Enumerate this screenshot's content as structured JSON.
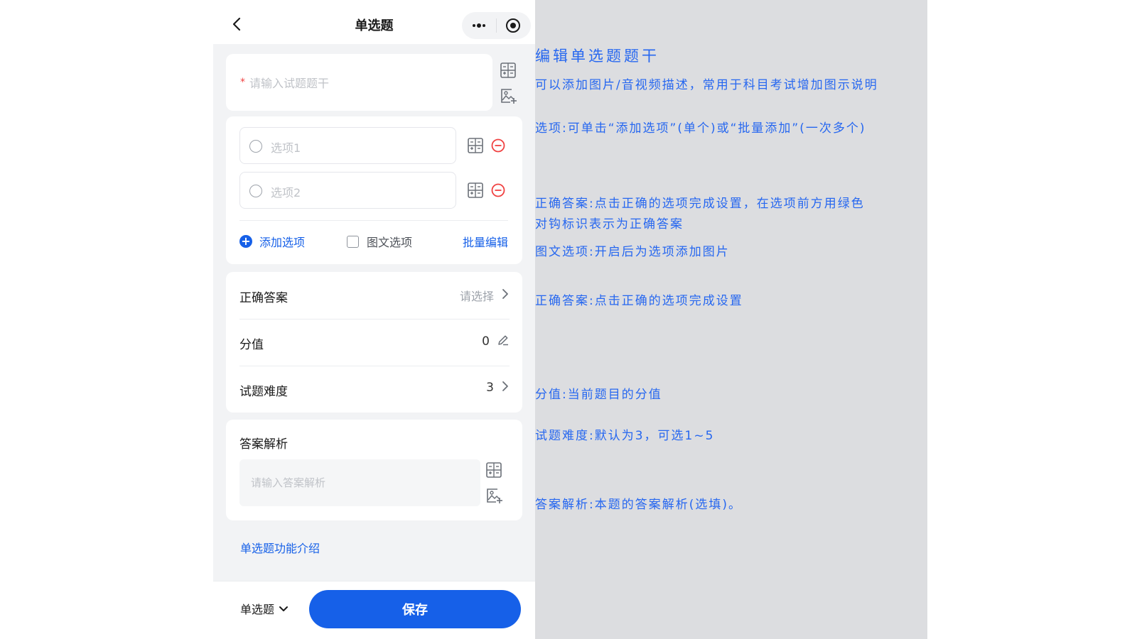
{
  "header": {
    "title": "单选题"
  },
  "stem": {
    "required_mark": "*",
    "placeholder": "请输入试题题干"
  },
  "options": {
    "items": [
      {
        "label": "选项1"
      },
      {
        "label": "选项2"
      }
    ],
    "add_label": "添加选项",
    "image_option_label": "图文选项",
    "batch_edit_label": "批量编辑"
  },
  "settings": {
    "correct_answer": {
      "label": "正确答案",
      "hint": "请选择"
    },
    "score": {
      "label": "分值",
      "value": "0"
    },
    "difficulty": {
      "label": "试题难度",
      "value": "3"
    }
  },
  "analysis": {
    "title": "答案解析",
    "placeholder": "请输入答案解析"
  },
  "intro_link": "单选题功能介绍",
  "bottom": {
    "type_label": "单选题",
    "save_label": "保存"
  },
  "annotations": {
    "stem_title": "编辑单选题题干",
    "stem_desc": "可以添加图片/音视频描述，常用于科目考试增加图示说明",
    "options": "选项:可单击“添加选项”(单个)或“批量添加”(一次多个)",
    "correct_line1": "正确答案:点击正确的选项完成设置，在选项前方用绿色",
    "correct_line2": "对钩标识表示为正确答案",
    "image_option": "图文选项:开启后为选项添加图片",
    "correct_answer": "正确答案:点击正确的选项完成设置",
    "score": "分值:当前题目的分值",
    "difficulty": "试题难度:默认为3，可选1~5",
    "analysis": "答案解析:本题的答案解析(选填)。"
  },
  "colors": {
    "accent": "#1660e8",
    "annotation_text": "#2667f0",
    "delete": "#f04141",
    "annotation_bg": "#dcdde0"
  }
}
